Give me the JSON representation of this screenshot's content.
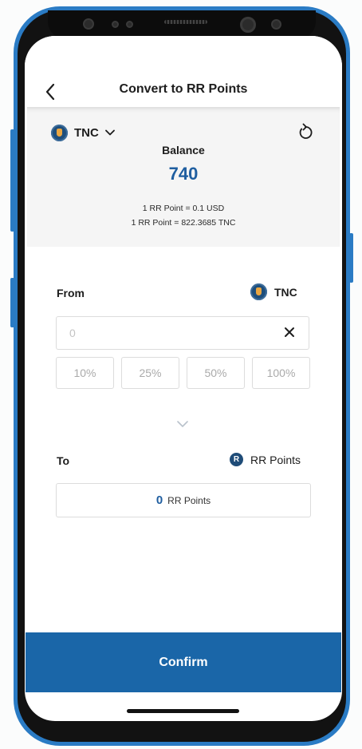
{
  "header": {
    "title": "Convert to RR Points"
  },
  "balance_panel": {
    "token_name": "TNC",
    "balance_label": "Balance",
    "balance_value": "740",
    "rate_usd": "1 RR Point = 0.1 USD",
    "rate_tnc": "1 RR Point = 822.3685 TNC"
  },
  "from_section": {
    "label": "From",
    "asset": "TNC",
    "amount_placeholder": "0",
    "percent_options": [
      "10%",
      "25%",
      "50%",
      "100%"
    ]
  },
  "to_section": {
    "label": "To",
    "asset": "RR Points",
    "amount": "0",
    "unit": "RR Points"
  },
  "footer": {
    "confirm_label": "Confirm"
  },
  "icons": {
    "back": "chevron-left-icon",
    "token_dropdown": "chevron-down-icon",
    "refresh": "refresh-icon",
    "clear": "close-icon",
    "swap_direction": "chevron-down-icon"
  },
  "colors": {
    "accent": "#1f5ea0",
    "confirm_button": "#1a66a8",
    "phone_frame": "#2a7bc4"
  }
}
